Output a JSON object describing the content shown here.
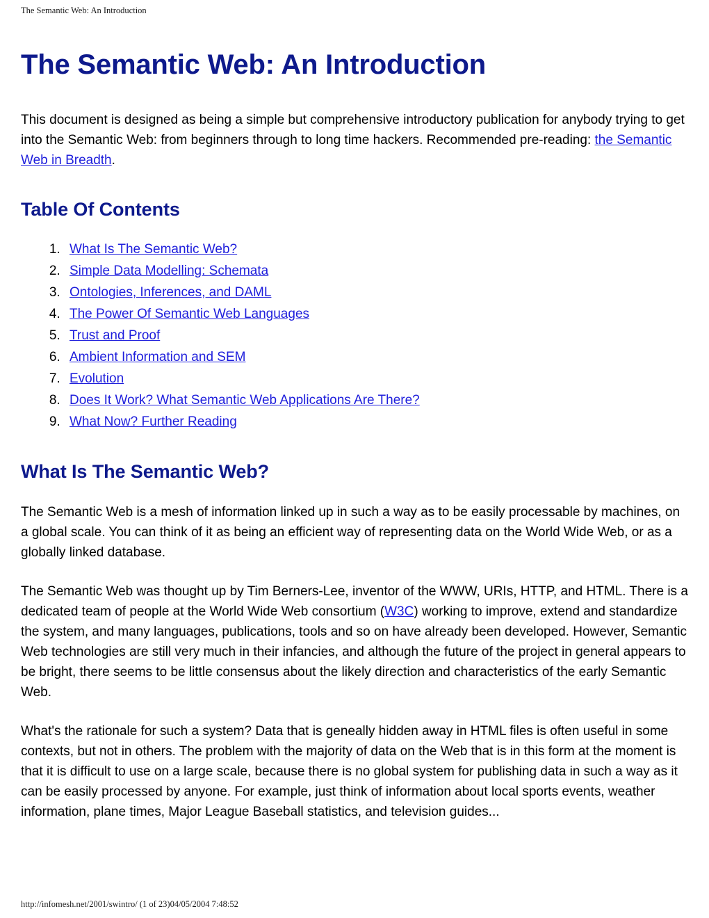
{
  "page": {
    "running_header": "The Semantic Web: An Introduction",
    "running_footer": "http://infomesh.net/2001/swintro/ (1 of 23)04/05/2004 7:48:52",
    "title": "The Semantic Web: An Introduction",
    "colors": {
      "heading": "#0e1a8c",
      "link": "#1e1edc",
      "text": "#000000",
      "background": "#ffffff"
    }
  },
  "intro": {
    "text_before_link": "This document is designed as being a simple but comprehensive introductory publication for anybody trying to get into the Semantic Web: from beginners through to long time hackers. Recommended pre-reading: ",
    "link_label": "the Semantic Web in Breadth",
    "text_after_link": "."
  },
  "toc": {
    "heading": "Table Of Contents",
    "items": [
      {
        "number": "1.",
        "label": "What Is The Semantic Web?"
      },
      {
        "number": "2.",
        "label": "Simple Data Modelling: Schemata"
      },
      {
        "number": "3.",
        "label": "Ontologies, Inferences, and DAML"
      },
      {
        "number": "4.",
        "label": "The Power Of Semantic Web Languages"
      },
      {
        "number": "5.",
        "label": "Trust and Proof"
      },
      {
        "number": "6.",
        "label": "Ambient Information and SEM"
      },
      {
        "number": "7.",
        "label": "Evolution"
      },
      {
        "number": "8.",
        "label": "Does It Work? What Semantic Web Applications Are There?"
      },
      {
        "number": "9.",
        "label": "What Now? Further Reading"
      }
    ]
  },
  "section_what_is": {
    "heading": "What Is The Semantic Web?",
    "paragraph_1": "The Semantic Web is a mesh of information linked up in such a way as to be easily processable by machines, on a global scale. You can think of it as being an efficient way of representing data on the World Wide Web, or as a globally linked database.",
    "paragraph_2_before_link": "The Semantic Web was thought up by Tim Berners-Lee, inventor of the WWW, URIs, HTTP, and HTML. There is a dedicated team of people at the World Wide Web consortium (",
    "paragraph_2_link_label": "W3C",
    "paragraph_2_after_link": ") working to improve, extend and standardize the system, and many languages, publications, tools and so on have already been developed. However, Semantic Web technologies are still very much in their infancies, and although the future of the project in general appears to be bright, there seems to be little consensus about the likely direction and characteristics of the early Semantic Web.",
    "paragraph_3": "What's the rationale for such a system? Data that is geneally hidden away in HTML files is often useful in some contexts, but not in others. The problem with the majority of data on the Web that is in this form at the moment is that it is difficult to use on a large scale, because there is no global system for publishing data in such a way as it can be easily processed by anyone. For example, just think of information about local sports events, weather information, plane times, Major League Baseball statistics, and television guides..."
  }
}
